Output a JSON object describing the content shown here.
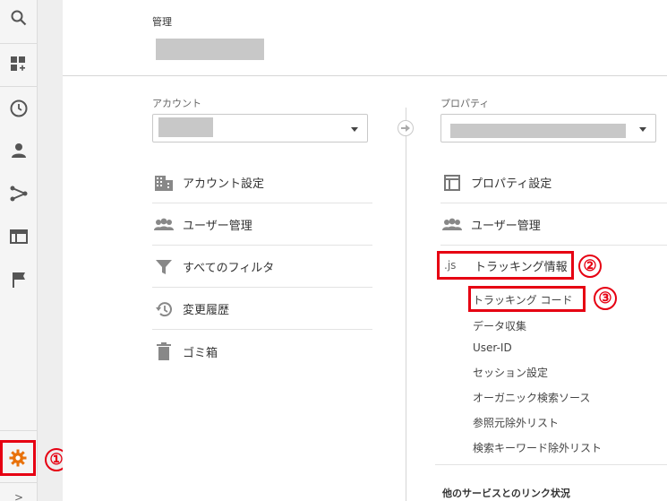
{
  "admin_title": "管理",
  "account_column": {
    "label": "アカウント",
    "items": [
      {
        "label": "アカウント設定",
        "icon": "building-icon"
      },
      {
        "label": "ユーザー管理",
        "icon": "users-icon"
      },
      {
        "label": "すべてのフィルタ",
        "icon": "filter-icon"
      },
      {
        "label": "変更履歴",
        "icon": "history-icon"
      },
      {
        "label": "ゴミ箱",
        "icon": "trash-icon"
      }
    ]
  },
  "property_column": {
    "label": "プロパティ",
    "items": [
      {
        "label": "プロパティ設定",
        "icon": "window-icon"
      },
      {
        "label": "ユーザー管理",
        "icon": "users-icon"
      },
      {
        "label": "トラッキング情報",
        "icon": "js-icon",
        "icon_text": ".js"
      }
    ],
    "tracking_subitems": [
      "トラッキング コード",
      "データ収集",
      "User-ID",
      "セッション設定",
      "オーガニック検索ソース",
      "参照元除外リスト",
      "検索キーワード除外リスト"
    ],
    "bottom_section": "他のサービスとのリンク状況"
  },
  "sidebar": {
    "icons": [
      "search-icon",
      "dashboard-icon",
      "clock-icon",
      "person-icon",
      "acquisition-icon",
      "behavior-icon",
      "flag-icon",
      "admin-gear-icon"
    ]
  },
  "annotations": [
    "①",
    "②",
    "③"
  ],
  "colors": {
    "accent": "#e8710a",
    "highlight": "#e60012"
  }
}
